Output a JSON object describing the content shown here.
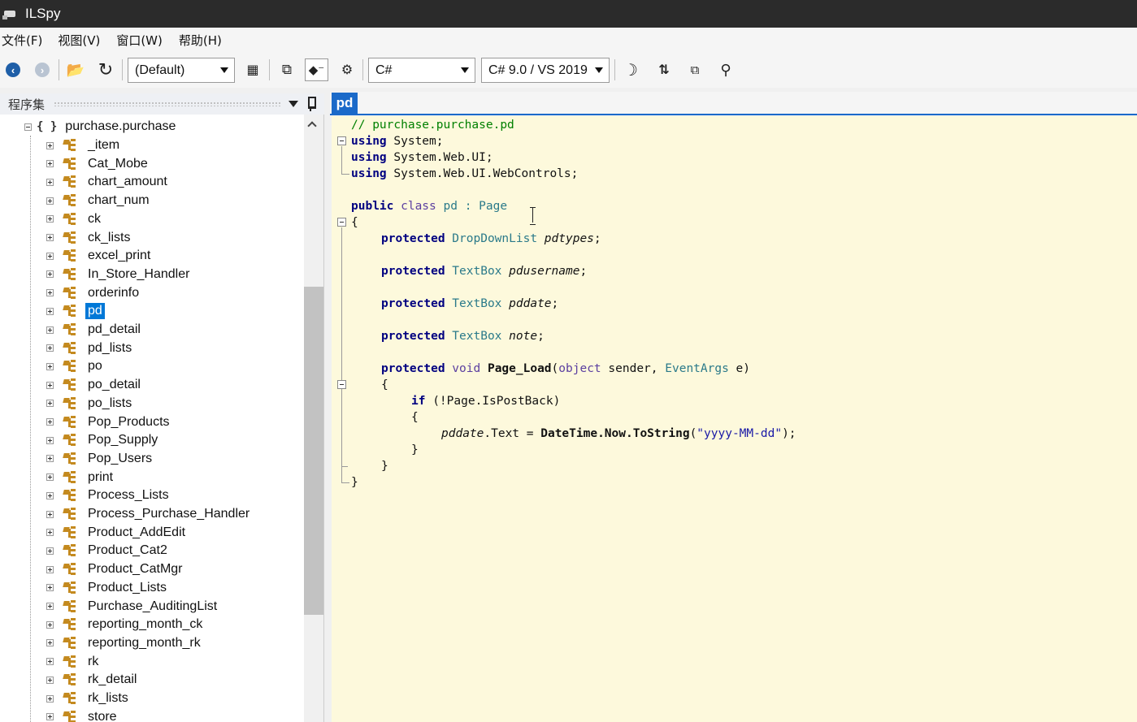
{
  "window": {
    "title": "ILSpy"
  },
  "menu": [
    "文件(F)",
    "视图(V)",
    "窗口(W)",
    "帮助(H)"
  ],
  "toolbar": {
    "view_combo": "(Default)",
    "language_combo": "C#",
    "version_combo": "C# 9.0 / VS 2019",
    "icons": [
      "back-icon",
      "forward-icon",
      "open-icon",
      "refresh-icon",
      "show-members-icon",
      "collapse-all-icon",
      "toggle-compiler-generated-icon",
      "decompile-settings-icon",
      "theme-moon-icon",
      "sort-icon",
      "new-window-icon",
      "search-icon"
    ]
  },
  "assembly_panel": {
    "title": "程序集",
    "root": {
      "label": "purchase.purchase",
      "icon": "{ }"
    },
    "items": [
      "_item",
      "Cat_Mobe",
      "chart_amount",
      "chart_num",
      "ck",
      "ck_lists",
      "excel_print",
      "In_Store_Handler",
      "orderinfo",
      "pd",
      "pd_detail",
      "pd_lists",
      "po",
      "po_detail",
      "po_lists",
      "Pop_Products",
      "Pop_Supply",
      "Pop_Users",
      "print",
      "Process_Lists",
      "Process_Purchase_Handler",
      "Product_AddEdit",
      "Product_Cat2",
      "Product_CatMgr",
      "Product_Lists",
      "Purchase_AuditingList",
      "reporting_month_ck",
      "reporting_month_rk",
      "rk",
      "rk_detail",
      "rk_lists",
      "store"
    ],
    "selected": "pd"
  },
  "editor": {
    "tab": "pd",
    "code": {
      "comment": "// purchase.purchase.pd",
      "u1_kw": "using",
      "u1_ns": " System;",
      "u2_kw": "using",
      "u2_ns": " System.Web.UI;",
      "u3_kw": "using",
      "u3_ns": " System.Web.UI.WebControls;",
      "c_public": "public",
      "c_class": " class",
      "c_rest": " pd : Page",
      "open_brace": "{",
      "f1_kw": "protected",
      "f1_type": " DropDownList",
      "f1_name": " pdtypes",
      "f1_end": ";",
      "f2_kw": "protected",
      "f2_type": " TextBox",
      "f2_name": " pdusername",
      "f2_end": ";",
      "f3_kw": "protected",
      "f3_type": " TextBox",
      "f3_name": " pddate",
      "f3_end": ";",
      "f4_kw": "protected",
      "f4_type": " TextBox",
      "f4_name": " note",
      "f4_end": ";",
      "m_kw": "protected",
      "m_void": " void",
      "m_name": " Page_Load",
      "m_p1": "(",
      "m_object": "object",
      "m_p2": " sender, ",
      "m_ea": "EventArgs",
      "m_p3": " e)",
      "m_open": "{",
      "if_kw": "if",
      "if_rest": " (!Page.IsPostBack)",
      "if_open": "{",
      "s_var": "pddate",
      "s_mid": ".Text = ",
      "s_dt": "DateTime.Now.ToString",
      "s_p1": "(",
      "s_str": "\"yyyy-MM-dd\"",
      "s_p2": ");",
      "if_close": "}",
      "m_close": "}",
      "class_close": "}"
    }
  },
  "colors": {
    "selection": "#0078d7",
    "accent": "#1b6ac9",
    "editor_bg": "#fdf9dc",
    "class_icon": "#c48a1f"
  }
}
